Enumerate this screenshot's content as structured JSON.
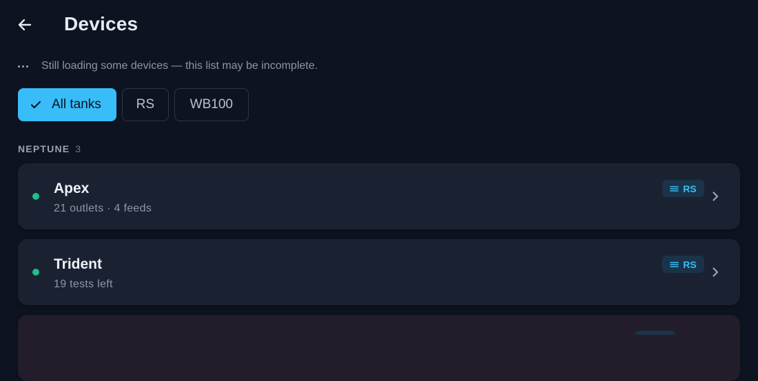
{
  "header": {
    "title": "Devices"
  },
  "status": {
    "loading_text": "Still loading some devices — this list may be incomplete."
  },
  "filters": [
    {
      "label": "All tanks",
      "selected": true
    },
    {
      "label": "RS",
      "selected": false
    },
    {
      "label": "WB100",
      "selected": false
    }
  ],
  "group": {
    "name": "NEPTUNE",
    "count": "3"
  },
  "devices": [
    {
      "name": "Apex",
      "subtitle": "21 outlets · 4 feeds",
      "badge": "RS",
      "status": "online"
    },
    {
      "name": "Trident",
      "subtitle": "19 tests left",
      "badge": "RS",
      "status": "online"
    }
  ],
  "colors": {
    "accent": "#38bdf8",
    "online": "#1ec08a",
    "background": "#0d1320",
    "card": "#1a2231"
  },
  "icons": {
    "back": "arrow-left-icon",
    "loading": "ellipsis-icon",
    "selected": "check-icon",
    "badge": "menu-lines-icon",
    "row": "chevron-right-icon"
  }
}
